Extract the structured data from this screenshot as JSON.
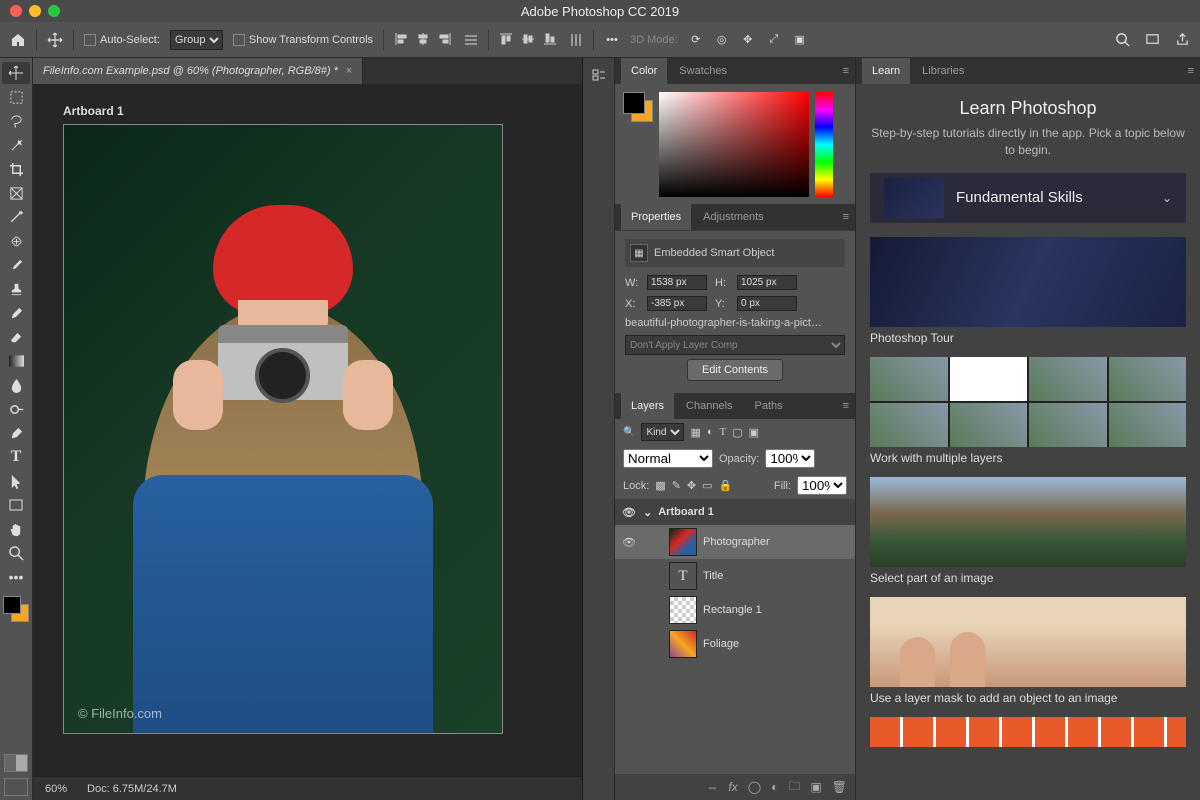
{
  "titlebar": {
    "title": "Adobe Photoshop CC 2019"
  },
  "optbar": {
    "auto_select": "Auto-Select:",
    "group": "Group",
    "show_transform": "Show Transform Controls",
    "mode_3d": "3D Mode:"
  },
  "doc_tab": {
    "title": "FileInfo.com Example.psd @ 60% (Photographer, RGB/8#) *"
  },
  "artboard_label": "Artboard 1",
  "watermark": "© FileInfo.com",
  "statusbar": {
    "zoom": "60%",
    "doc": "Doc: 6.75M/24.7M"
  },
  "color_panel": {
    "tabs": [
      "Color",
      "Swatches"
    ]
  },
  "properties": {
    "tabs": [
      "Properties",
      "Adjustments"
    ],
    "kind": "Embedded Smart Object",
    "w_label": "W:",
    "w": "1538 px",
    "h_label": "H:",
    "h": "1025 px",
    "x_label": "X:",
    "x": "-385 px",
    "y_label": "Y:",
    "y": "0 px",
    "filename": "beautiful-photographer-is-taking-a-pict…",
    "layer_comp": "Don't Apply Layer Comp",
    "edit_btn": "Edit Contents"
  },
  "layers": {
    "tabs": [
      "Layers",
      "Channels",
      "Paths"
    ],
    "filter": "Kind",
    "blend": "Normal",
    "opacity_label": "Opacity:",
    "opacity": "100%",
    "lock": "Lock:",
    "fill_label": "Fill:",
    "fill": "100%",
    "items": [
      {
        "name": "Artboard 1",
        "type": "artboard"
      },
      {
        "name": "Photographer",
        "type": "photo",
        "selected": true
      },
      {
        "name": "Title",
        "type": "text"
      },
      {
        "name": "Rectangle 1",
        "type": "check"
      },
      {
        "name": "Foliage",
        "type": "foliage"
      }
    ]
  },
  "learn": {
    "tabs": [
      "Learn",
      "Libraries"
    ],
    "heading": "Learn Photoshop",
    "sub": "Step-by-step tutorials directly in the app. Pick a topic below to begin.",
    "category": "Fundamental Skills",
    "tutorials": [
      "Photoshop Tour",
      "Work with multiple layers",
      "Select part of an image",
      "Use a layer mask to add an object to an image"
    ]
  }
}
